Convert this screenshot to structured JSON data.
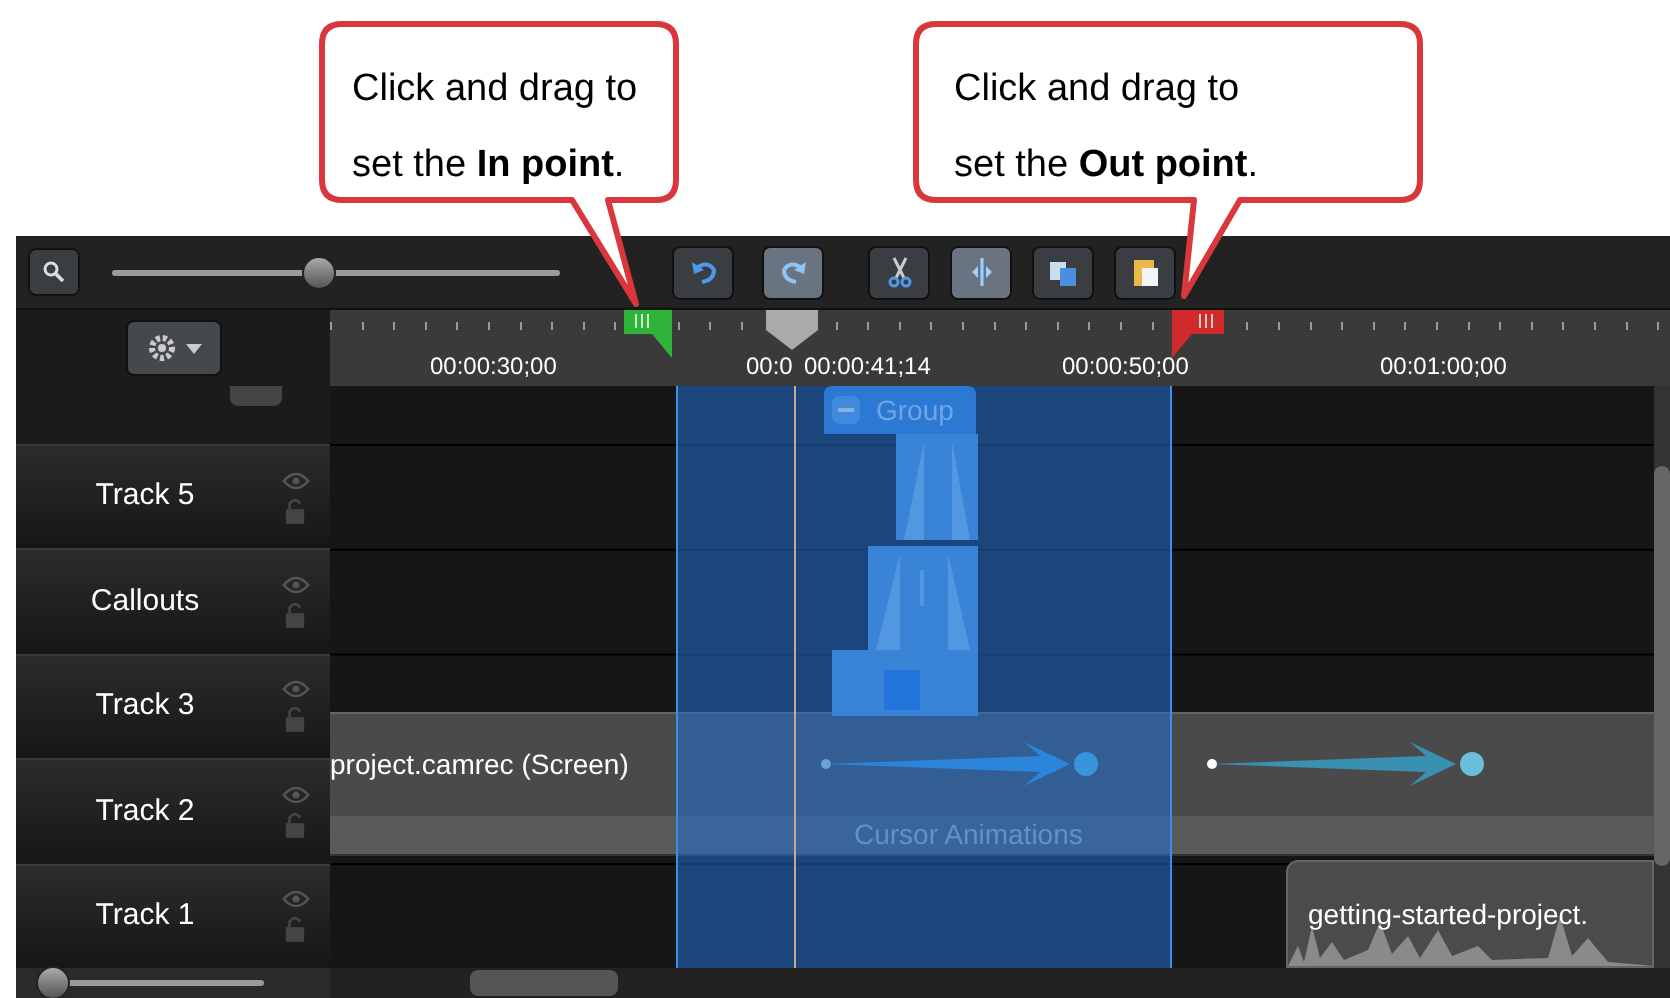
{
  "callouts": [
    {
      "kind": "in",
      "text": "Click and drag to set the **In point**."
    },
    {
      "kind": "out",
      "text": "Click and drag to set the **Out point**."
    }
  ],
  "toolbar": {
    "zoom_slider": {
      "level": 0.49
    },
    "buttons": [
      {
        "kind": "zoom"
      },
      {
        "kind": "undo"
      },
      {
        "kind": "redo"
      },
      {
        "kind": "cut"
      },
      {
        "kind": "split"
      },
      {
        "kind": "copy"
      },
      {
        "kind": "paste"
      }
    ]
  },
  "ruler": {
    "labels": [
      "00:00:30;00",
      "00:0",
      "00:00:50;00",
      "00:01:00;00"
    ],
    "playhead": "00:00:41;14"
  },
  "tracks": [
    {
      "name": "Track 5"
    },
    {
      "name": "Callouts"
    },
    {
      "name": "Track 3"
    },
    {
      "name": "Track 2"
    },
    {
      "name": "Track 1"
    }
  ],
  "clips": [
    {
      "kind": "group",
      "label": "Group"
    },
    {
      "kind": "screen",
      "label": "project.camrec (Screen)"
    },
    {
      "kind": "cursor",
      "label": "Cursor Animations"
    },
    {
      "kind": "audio",
      "label": "getting-started-project."
    }
  ],
  "bottom": {
    "track_size_slider": {
      "level": 0
    }
  }
}
